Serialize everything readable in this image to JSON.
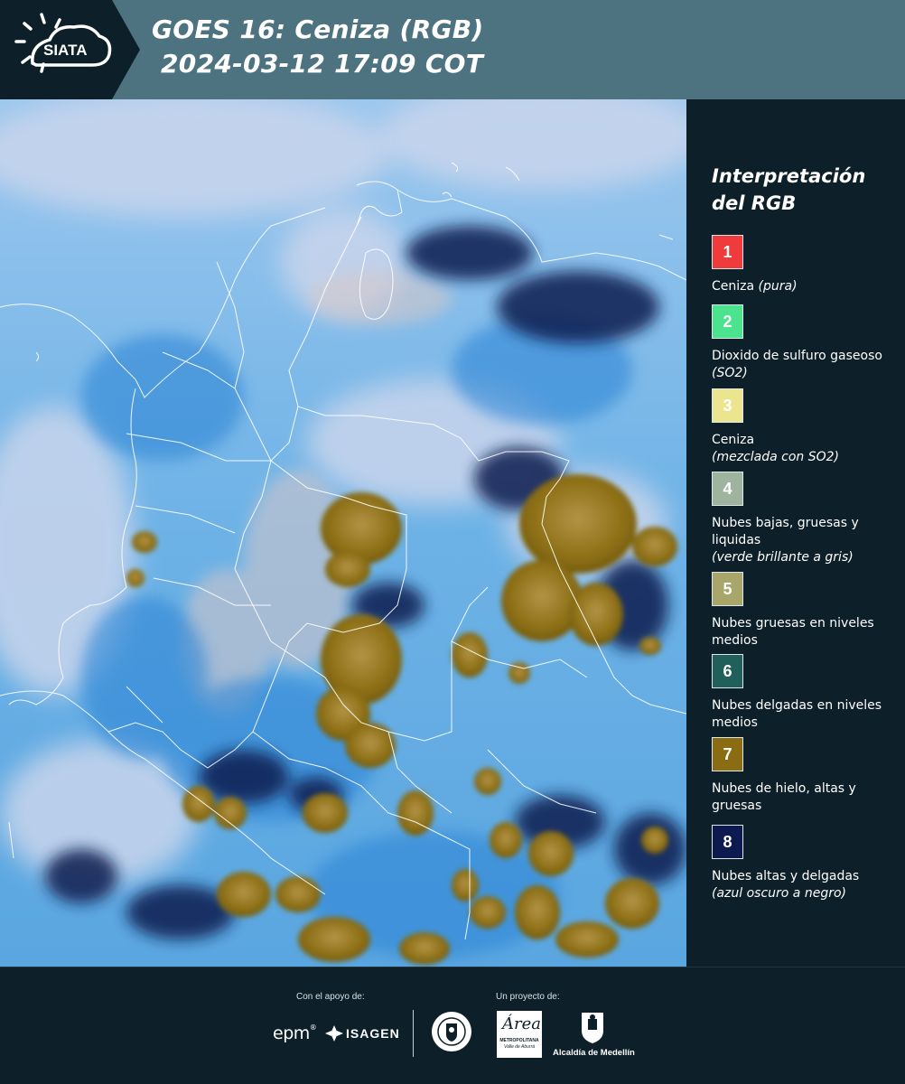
{
  "header": {
    "logo_text": "SIATA",
    "title_line1": "GOES 16: Ceniza (RGB)",
    "title_line2": "2024-03-12 17:09 COT"
  },
  "legend": {
    "title": "Interpretación del RGB",
    "items": [
      {
        "number": "1",
        "label": "Ceniza",
        "note": "(pura)",
        "color": "#ef3b3b"
      },
      {
        "number": "2",
        "label": "Dioxido de sulfuro gaseoso",
        "note": "(SO2)",
        "color": "#4be38d"
      },
      {
        "number": "3",
        "label": "Ceniza",
        "note": "(mezclada con SO2)",
        "color": "#ece58f"
      },
      {
        "number": "4",
        "label": "Nubes bajas, gruesas y liquidas",
        "note": "(verde brillante a gris)",
        "color": "#9fb49f"
      },
      {
        "number": "5",
        "label": "Nubes gruesas en niveles medios",
        "note": "",
        "color": "#a9a66c"
      },
      {
        "number": "6",
        "label": "Nubes delgadas en niveles medios",
        "note": "",
        "color": "#21605a"
      },
      {
        "number": "7",
        "label": "Nubes de hielo, altas y gruesas",
        "note": "",
        "color": "#8a6d12"
      },
      {
        "number": "8",
        "label": "Nubes altas y delgadas",
        "note": "(azul oscuro a negro)",
        "color": "#0d1a4f"
      }
    ]
  },
  "footer": {
    "support_caption": "Con el apoyo de:",
    "project_caption": "Un proyecto de:",
    "sponsor_1": "epm",
    "sponsor_2": "ISAGEN",
    "area_logo_text": "Área",
    "area_subtitle": "METROPOLITANA",
    "area_subtitle2": "Valle de Aburrá",
    "alcaldia_label": "Alcaldía de Medellín"
  },
  "colors": {
    "header_bg": "#4e7380",
    "panel_bg": "#0d1f29",
    "map_sky_blue": "#7fbfe9",
    "ice_cloud": "#8a6d12"
  }
}
